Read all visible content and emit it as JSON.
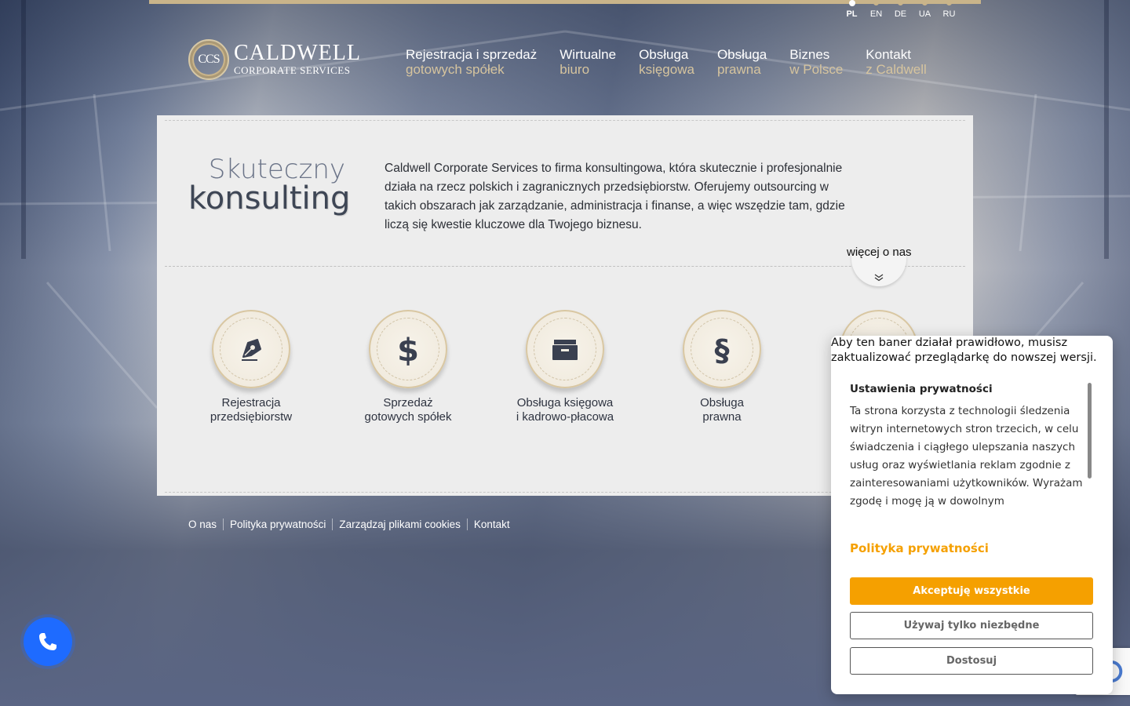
{
  "languages": [
    {
      "code": "PL",
      "active": true
    },
    {
      "code": "EN",
      "active": false
    },
    {
      "code": "DE",
      "active": false
    },
    {
      "code": "UA",
      "active": false
    },
    {
      "code": "RU",
      "active": false
    }
  ],
  "logo": {
    "seal": "CCS",
    "name": "CALDWELL",
    "subtitle": "CORPORATE SERVICES"
  },
  "nav": [
    {
      "top": "Rejestracja i sprzedaż",
      "bottom": "gotowych spółek"
    },
    {
      "top": "Wirtualne",
      "bottom": "biuro"
    },
    {
      "top": "Obsługa",
      "bottom": "księgowa"
    },
    {
      "top": "Obsługa",
      "bottom": "prawna"
    },
    {
      "top": "Biznes",
      "bottom": "w Polsce"
    },
    {
      "top": "Kontakt",
      "bottom": "z Caldwell"
    }
  ],
  "hero": {
    "headline_line1": "Skuteczny",
    "headline_line2": "konsulting",
    "intro": "Caldwell Corporate Services to firma konsultingowa, która skutecznie i profesjonalnie działa na rzecz polskich i zagranicznych przedsiębiorstw. Oferujemy outsourcing w takich obszarach jak zarządzanie, administracja i finanse, a więc wszędzie tam, gdzie liczą się kwestie kluczowe dla Twojego biznesu.",
    "more_label": "więcej o nas"
  },
  "services": [
    {
      "icon": "pen-nib-icon",
      "line1": "Rejestracja",
      "line2": "przedsiębiorstw"
    },
    {
      "icon": "dollar-icon",
      "line1": "Sprzedaż",
      "line2": "gotowych spółek"
    },
    {
      "icon": "archive-icon",
      "line1": "Obsługa księgowa",
      "line2": "i kadrowo-płacowa"
    },
    {
      "icon": "paragraph-icon",
      "line1": "Obsługa",
      "line2": "prawna"
    }
  ],
  "footer_links": [
    "O nas",
    "Polityka prywatności",
    "Zarządzaj plikami cookies",
    "Kontakt"
  ],
  "cookie_banner": {
    "browser_warning": "Aby ten baner działał prawidłowo, musisz zaktualizować przeglądarkę do nowszej wersji.",
    "title": "Ustawienia prywatności",
    "body": "Ta strona korzysta z technologii śledzenia witryn internetowych stron trzecich, w celu świadczenia i ciągłego ulepszania naszych usług oraz wyświetlania reklam zgodnie z zainteresowaniami użytkowników. Wyrażam zgodę i mogę ją w dowolnym",
    "policy_link": "Polityka prywatności",
    "accept_label": "Akceptuję wszystkie",
    "necessary_label": "Używaj tylko niezbędne",
    "customize_label": "Dostosuj",
    "accent_color": "#f5a000"
  },
  "colors": {
    "gold": "#c9b48a",
    "phone_button": "#1e6bff"
  }
}
